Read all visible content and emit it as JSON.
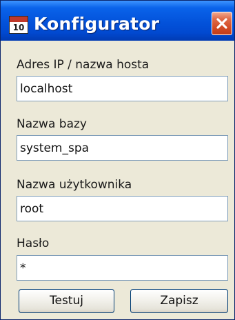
{
  "window": {
    "title": "Konfigurator",
    "icon_text": "10",
    "icon": "calendar-icon",
    "close_icon": "close-icon"
  },
  "form": {
    "fields": [
      {
        "label": "Adres IP / nazwa hosta",
        "value": "localhost"
      },
      {
        "label": "Nazwa bazy",
        "value": "system_spa"
      },
      {
        "label": "Nazwa użytkownika",
        "value": "root"
      },
      {
        "label": "Hasło",
        "value": "*"
      }
    ]
  },
  "buttons": {
    "test_label": "Testuj",
    "save_label": "Zapisz"
  },
  "colors": {
    "titlebar": "#0352da",
    "close_button": "#d24b25",
    "window_background": "#ece9d8",
    "field_border": "#7f9db9"
  }
}
